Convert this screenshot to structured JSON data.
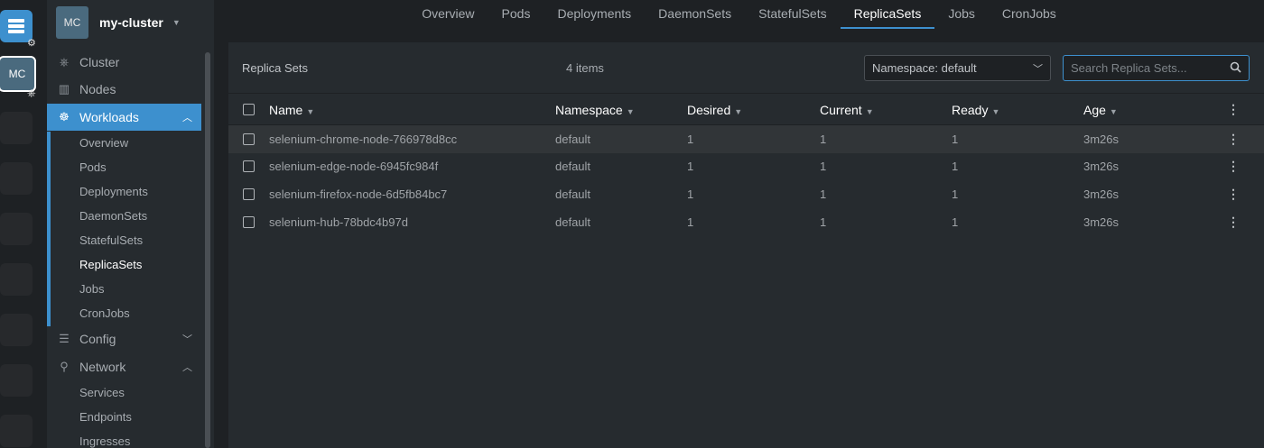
{
  "rail": {
    "cluster_short": "MC"
  },
  "sidebar": {
    "avatar": "MC",
    "cluster_name": "my-cluster",
    "items": [
      {
        "label": "Cluster",
        "icon": "helm-icon"
      },
      {
        "label": "Nodes",
        "icon": "nodes-icon"
      },
      {
        "label": "Workloads",
        "icon": "workloads-icon"
      },
      {
        "label": "Config",
        "icon": "list-icon"
      },
      {
        "label": "Network",
        "icon": "network-icon"
      }
    ],
    "workloads_sub": [
      "Overview",
      "Pods",
      "Deployments",
      "DaemonSets",
      "StatefulSets",
      "ReplicaSets",
      "Jobs",
      "CronJobs"
    ],
    "network_sub": [
      "Services",
      "Endpoints",
      "Ingresses"
    ]
  },
  "tabs": [
    "Overview",
    "Pods",
    "Deployments",
    "DaemonSets",
    "StatefulSets",
    "ReplicaSets",
    "Jobs",
    "CronJobs"
  ],
  "active_tab": "ReplicaSets",
  "panel": {
    "title": "Replica Sets",
    "count": "4 items",
    "namespace_select": "Namespace: default",
    "search_placeholder": "Search Replica Sets..."
  },
  "table": {
    "columns": [
      "Name",
      "Namespace",
      "Desired",
      "Current",
      "Ready",
      "Age"
    ],
    "rows": [
      {
        "name": "selenium-chrome-node-766978d8cc",
        "namespace": "default",
        "desired": "1",
        "current": "1",
        "ready": "1",
        "age": "3m26s"
      },
      {
        "name": "selenium-edge-node-6945fc984f",
        "namespace": "default",
        "desired": "1",
        "current": "1",
        "ready": "1",
        "age": "3m26s"
      },
      {
        "name": "selenium-firefox-node-6d5fb84bc7",
        "namespace": "default",
        "desired": "1",
        "current": "1",
        "ready": "1",
        "age": "3m26s"
      },
      {
        "name": "selenium-hub-78bdc4b97d",
        "namespace": "default",
        "desired": "1",
        "current": "1",
        "ready": "1",
        "age": "3m26s"
      }
    ]
  },
  "colors": {
    "accent": "#3d90ce",
    "background": "#1e2124",
    "panel": "#262b2f"
  }
}
